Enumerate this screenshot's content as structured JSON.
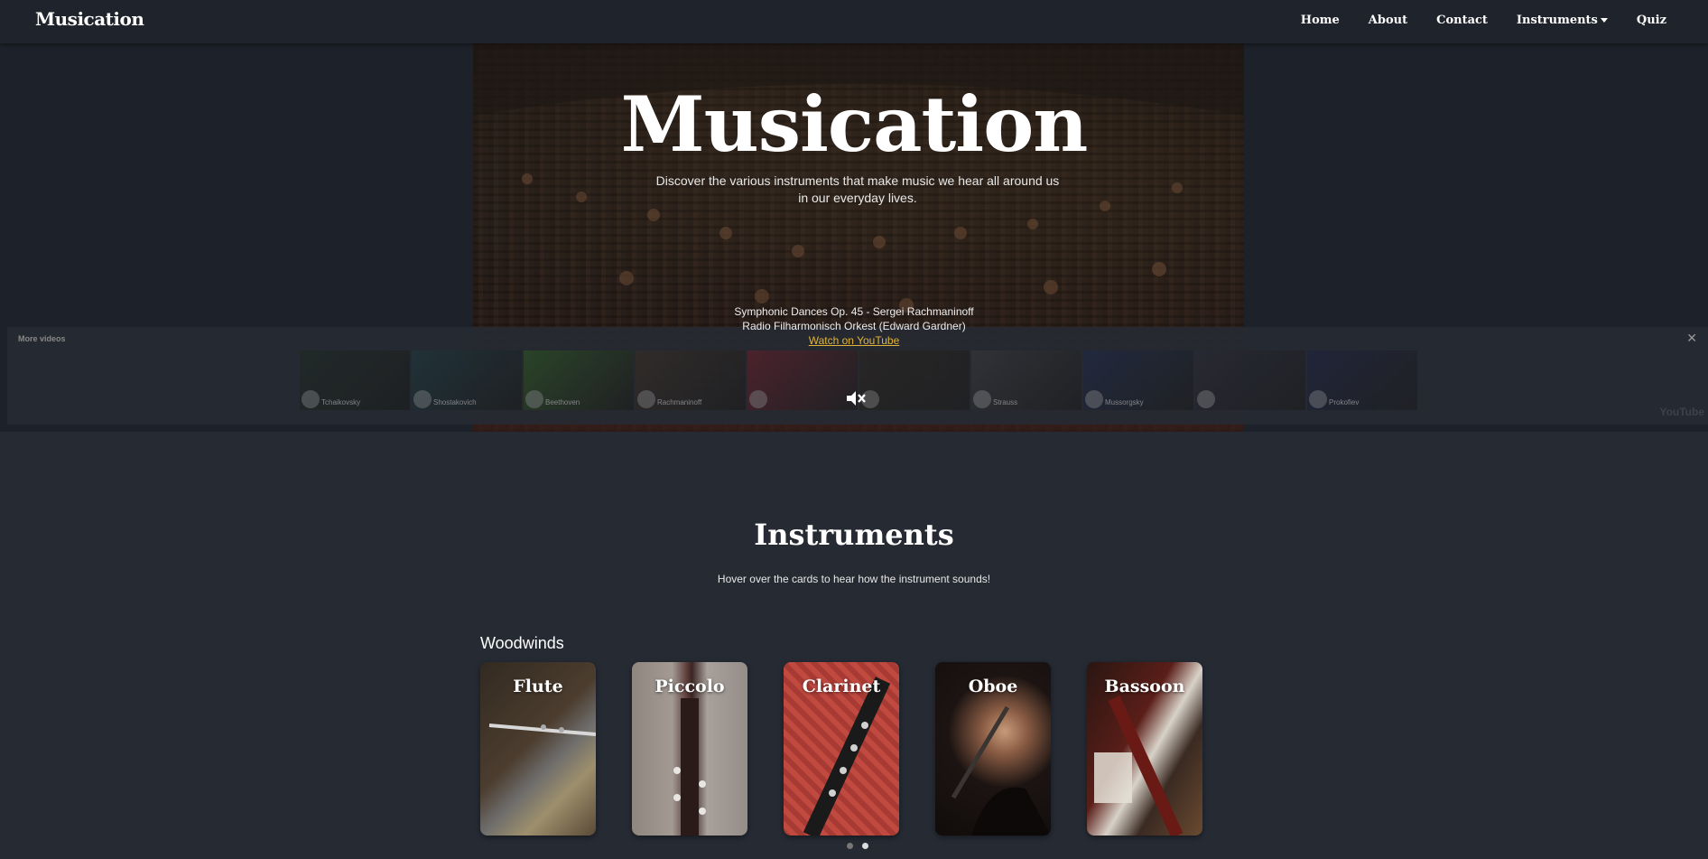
{
  "nav": {
    "brand": "Musication",
    "links": [
      "Home",
      "About",
      "Contact",
      "Instruments",
      "Quiz"
    ]
  },
  "hero": {
    "title": "Musication",
    "subtitle": "Discover the various instruments that make music we hear all around us in our everyday lives.",
    "video_title": "Symphonic Dances Op. 45 - Sergei Rachmaninoff",
    "video_channel": "Radio Filharmonisch Orkest (Edward Gardner)",
    "watch_link": "Watch on YouTube",
    "more_videos_label": "More videos",
    "youtube_mark": "YouTube",
    "thumbnails": [
      {
        "label": "Tchaikovsky",
        "color": "#1e2a22"
      },
      {
        "label": "Shostakovich",
        "color": "#1c3a3e"
      },
      {
        "label": "Beethoven",
        "color": "#2e5a22"
      },
      {
        "label": "Rachmaninoff",
        "color": "#3a2e26"
      },
      {
        "label": "",
        "color": "#6a1e2a"
      },
      {
        "label": "",
        "color": "#2a241e"
      },
      {
        "label": "Strauss",
        "color": "#3a3a3e"
      },
      {
        "label": "Mussorgsky",
        "color": "#1e2a4a"
      },
      {
        "label": "",
        "color": "#2a2a36"
      },
      {
        "label": "Prokofiev",
        "color": "#1e2240"
      }
    ]
  },
  "instruments": {
    "title": "Instruments",
    "subtitle": "Hover over the cards to hear how the instrument sounds!",
    "category": "Woodwinds",
    "cards": [
      "Flute",
      "Piccolo",
      "Clarinet",
      "Oboe",
      "Bassoon"
    ]
  },
  "carousel": {
    "pages": 2,
    "active": 2
  }
}
